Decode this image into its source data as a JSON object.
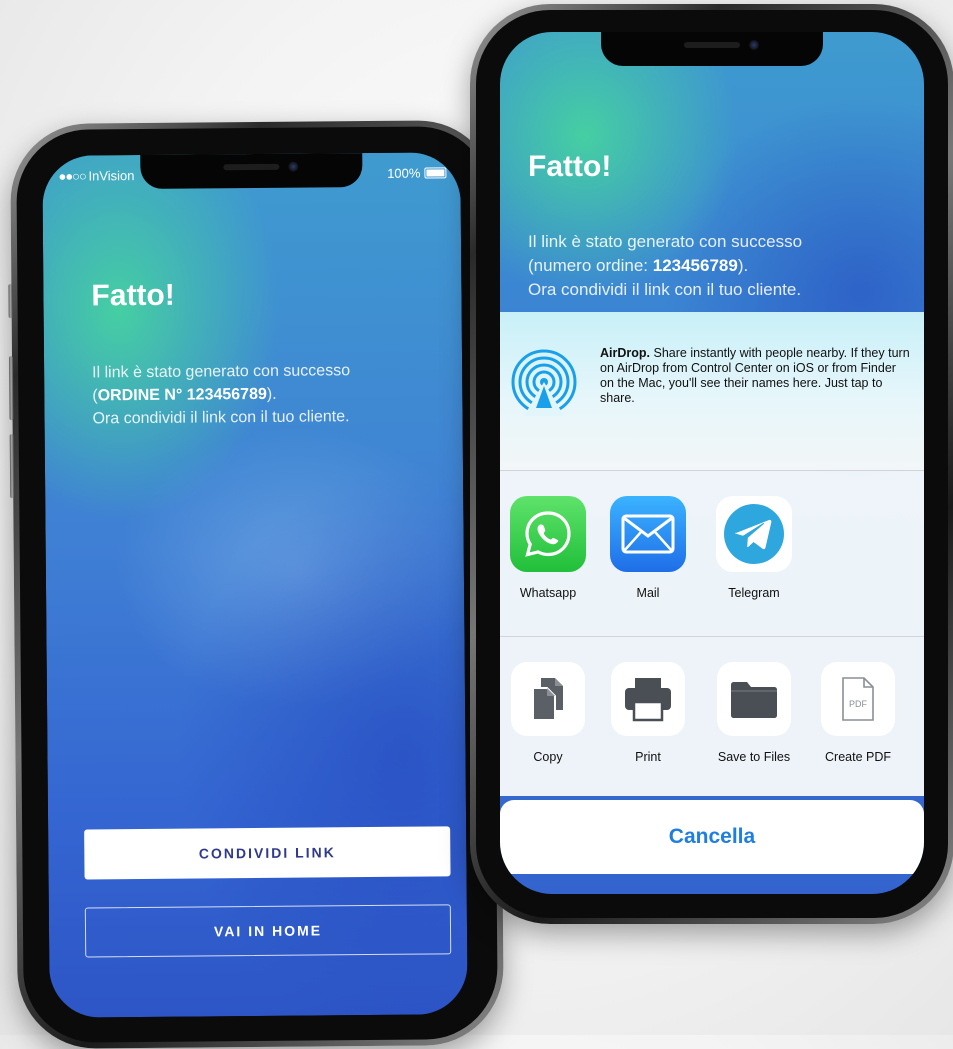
{
  "phone_left": {
    "status": {
      "carrier": "InVision",
      "battery": "100%"
    },
    "title": "Fatto!",
    "message": {
      "line1": "Il link è stato generato con successo",
      "line2_open": "(",
      "order_label": "ORDINE N° 123456789",
      "line2_close": ").",
      "line3": "Ora condividi il link con il tuo cliente."
    },
    "buttons": {
      "share": "CONDIVIDI LINK",
      "home": "VAI IN HOME"
    }
  },
  "phone_right": {
    "title": "Fatto!",
    "message": {
      "line1": "Il link è stato generato con successo",
      "line2_prefix": "(numero ordine: ",
      "order_number": "123456789",
      "line2_suffix": ").",
      "line3": "Ora condividi il link con il tuo cliente."
    },
    "share_sheet": {
      "airdrop": {
        "title": "AirDrop.",
        "description": "Share instantly with people nearby. If they turn on AirDrop from Control Center on iOS or from Finder on the Mac, you'll see their names here. Just tap to share."
      },
      "apps": [
        {
          "label": "Whatsapp",
          "icon": "whatsapp-icon"
        },
        {
          "label": "Mail",
          "icon": "mail-icon"
        },
        {
          "label": "Telegram",
          "icon": "telegram-icon"
        }
      ],
      "actions": [
        {
          "label": "Copy",
          "icon": "copy-icon"
        },
        {
          "label": "Print",
          "icon": "print-icon"
        },
        {
          "label": "Save to Files",
          "icon": "folder-icon"
        },
        {
          "label": "Create PDF",
          "icon": "pdf-icon",
          "icon_text": "PDF"
        }
      ],
      "cancel": "Cancella"
    }
  },
  "colors": {
    "accent_blue": "#1f7fe0",
    "button_text": "#2f3b8a",
    "whatsapp_green": "#25c63f",
    "mail_blue": "#1f8af0",
    "telegram_blue": "#2ea6de"
  }
}
